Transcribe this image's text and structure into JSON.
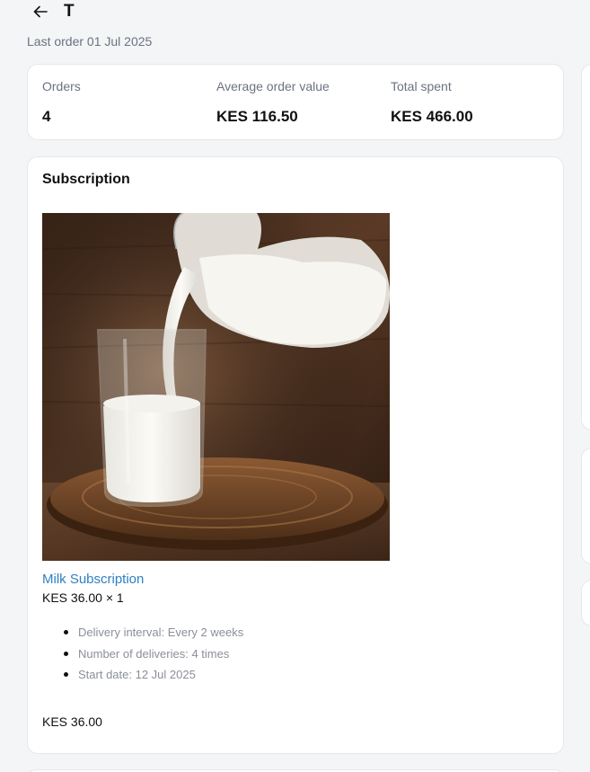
{
  "header": {
    "back_icon": "arrow-left-icon",
    "title": "T",
    "last_order": "Last order 01 Jul 2025"
  },
  "stats": [
    {
      "label": "Orders",
      "value": "4"
    },
    {
      "label": "Average order value",
      "value": "KES 116.50"
    },
    {
      "label": "Total spent",
      "value": "KES 466.00"
    }
  ],
  "subscription": {
    "heading": "Subscription",
    "product_image": "milk-pouring-photo",
    "product_name": "Milk Subscription",
    "product_price": "KES 36.00 × 1",
    "details": [
      "Delivery interval: Every 2 weeks",
      "Number of deliveries: 4 times",
      "Start date: 12 Jul 2025"
    ],
    "total": "KES 36.00"
  },
  "colors": {
    "link": "#2f80c2",
    "muted": "#6b7280",
    "background": "#f4f5f7"
  }
}
